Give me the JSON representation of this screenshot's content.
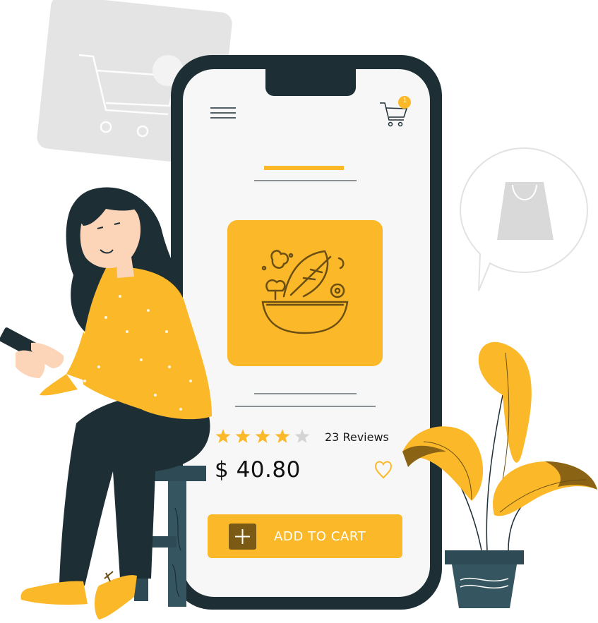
{
  "product": {
    "rating": 4,
    "rating_max": 5,
    "reviews_label": "23 Reviews",
    "price": "$ 40.80",
    "add_to_cart_label": "ADD TO CART",
    "image_icon": "salad-bowl-icon"
  },
  "header": {
    "menu_icon": "hamburger-menu-icon",
    "cart_icon": "cart-icon",
    "cart_count": "1"
  },
  "colors": {
    "accent": "#fbb829",
    "dark": "#1d2e35",
    "screen": "#f7f7f7",
    "accent_dark": "#7a5a14"
  }
}
